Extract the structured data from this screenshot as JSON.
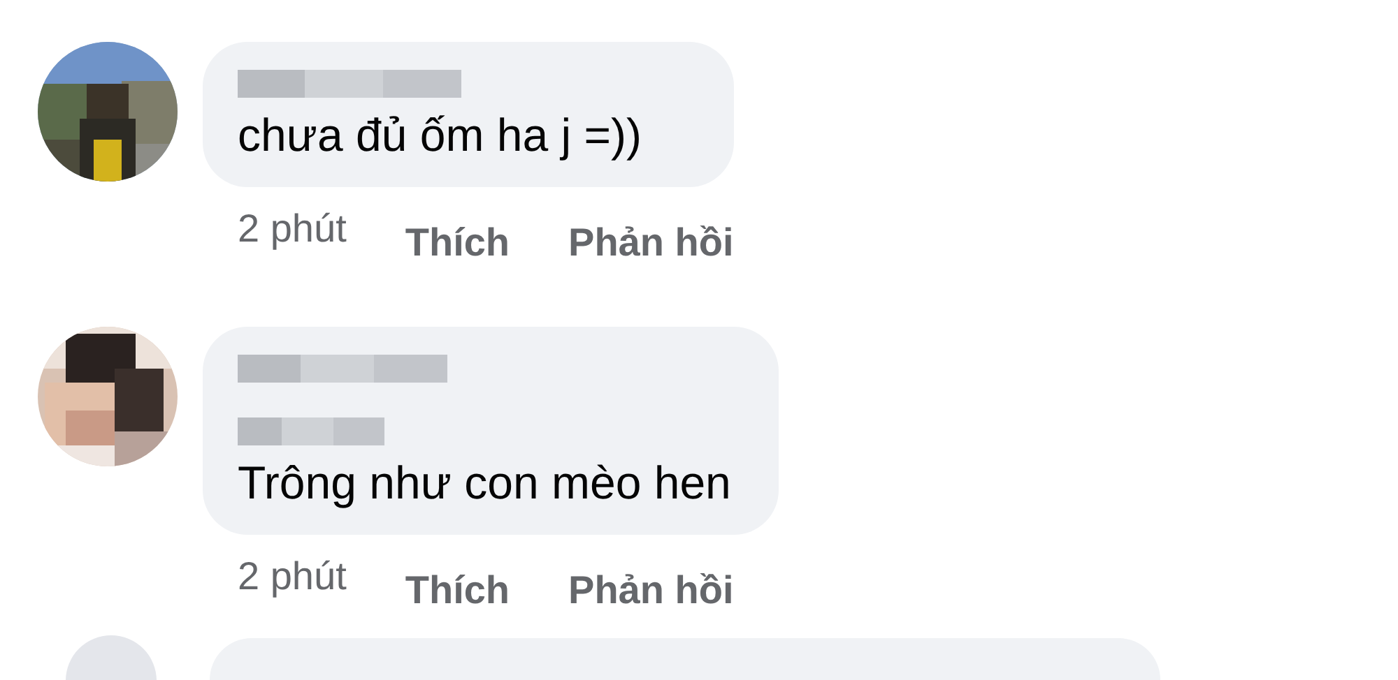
{
  "comments": [
    {
      "kind": "one-line-name",
      "text": "chưa đủ ốm ha j =))",
      "time": "2 phút",
      "like": "Thích",
      "reply": "Phản hồi"
    },
    {
      "kind": "two-line-name",
      "text": "Trông như con mèo hen",
      "time": "2 phút",
      "like": "Thích",
      "reply": "Phản hồi"
    }
  ]
}
